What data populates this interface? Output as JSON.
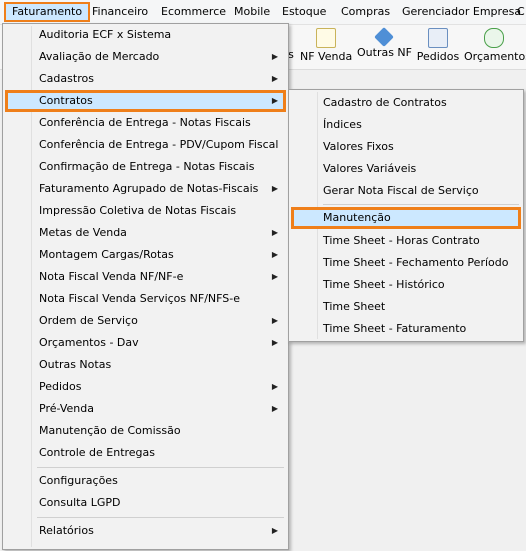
{
  "menubar": {
    "items": [
      "Faturamento",
      "Financeiro",
      "Ecommerce",
      "Mobile",
      "Estoque",
      "Compras",
      "Gerenciador Empresa",
      "C"
    ]
  },
  "toolbar": {
    "items": [
      {
        "label": "s",
        "icon": "toolbar-icon"
      },
      {
        "label": "NF Venda",
        "icon": "nf-venda-icon"
      },
      {
        "label": "Outras NF",
        "icon": "outras-nf-icon"
      },
      {
        "label": "Pedidos",
        "icon": "pedidos-icon"
      },
      {
        "label": "Orçamentos",
        "icon": "orcamentos-icon"
      }
    ]
  },
  "faturamento_menu": {
    "items": [
      {
        "label": "Auditoria ECF x Sistema",
        "submenu": false
      },
      {
        "label": "Avaliação de Mercado",
        "submenu": true
      },
      {
        "label": "Cadastros",
        "submenu": true
      },
      {
        "label": "Contratos",
        "submenu": true
      },
      {
        "label": "Conferência de Entrega - Notas Fiscais",
        "submenu": false
      },
      {
        "label": "Conferência de Entrega - PDV/Cupom Fiscal",
        "submenu": false
      },
      {
        "label": "Confirmação de Entrega - Notas Fiscais",
        "submenu": false
      },
      {
        "label": "Faturamento Agrupado de Notas-Fiscais",
        "submenu": true
      },
      {
        "label": "Impressão Coletiva de Notas Fiscais",
        "submenu": false
      },
      {
        "label": "Metas de Venda",
        "submenu": true
      },
      {
        "label": "Montagem Cargas/Rotas",
        "submenu": true
      },
      {
        "label": "Nota Fiscal Venda NF/NF-e",
        "submenu": true
      },
      {
        "label": "Nota Fiscal Venda Serviços NF/NFS-e",
        "submenu": false
      },
      {
        "label": "Ordem de Serviço",
        "submenu": true
      },
      {
        "label": "Orçamentos - Dav",
        "submenu": true
      },
      {
        "label": "Outras Notas",
        "submenu": false
      },
      {
        "label": "Pedidos",
        "submenu": true
      },
      {
        "label": "Pré-Venda",
        "submenu": true
      },
      {
        "label": "Manutenção de Comissão",
        "submenu": false
      },
      {
        "label": "Controle de Entregas",
        "submenu": false
      },
      {
        "label": "Configurações",
        "submenu": false
      },
      {
        "label": "Consulta LGPD",
        "submenu": false
      },
      {
        "label": "Relatórios",
        "submenu": true
      }
    ]
  },
  "contratos_submenu": {
    "items": [
      "Cadastro de Contratos",
      "Índices",
      "Valores Fixos",
      "Valores Variáveis",
      "Gerar Nota Fiscal de Serviço",
      "Manutenção",
      "Time Sheet - Horas Contrato",
      "Time Sheet - Fechamento Período",
      "Time Sheet - Histórico",
      "Time Sheet",
      "Time Sheet - Faturamento"
    ]
  },
  "colors": {
    "highlight": "#cce8ff",
    "accent_border": "#ef7f1a"
  }
}
